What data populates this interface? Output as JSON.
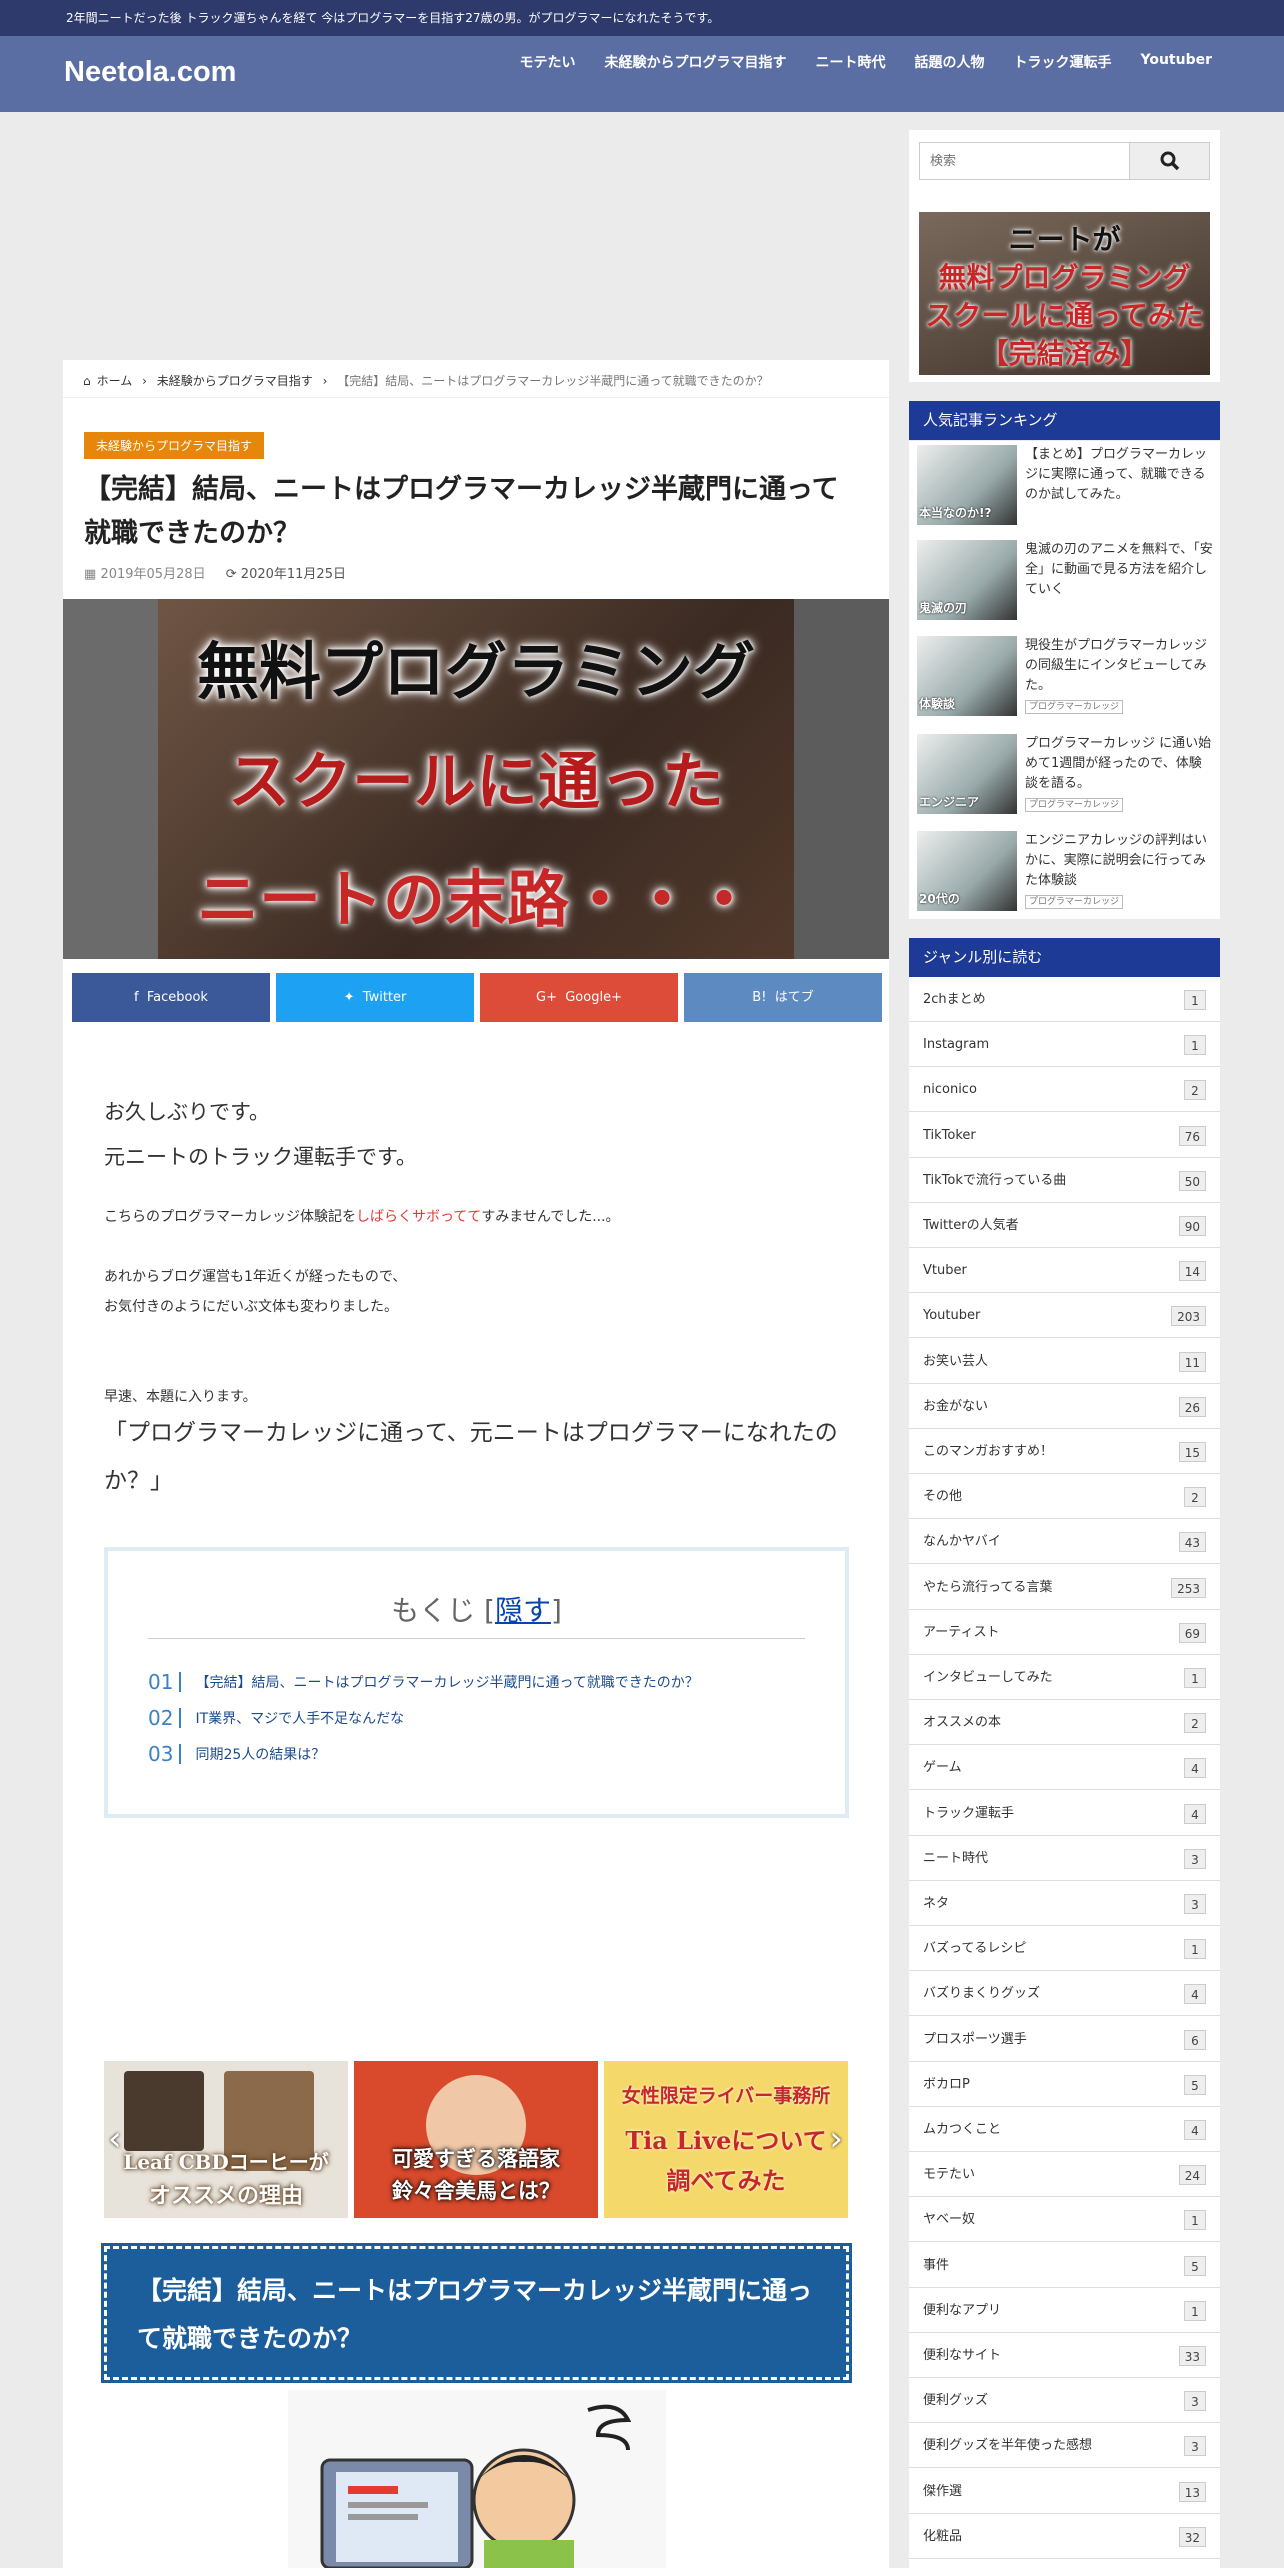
{
  "topbar": {
    "text": "2年間ニートだった後 トラック運ちゃんを経て 今はプログラマーを目指す27歳の男。がプログラマーになれたそうです。"
  },
  "header": {
    "logo": "Neetola.com",
    "nav": [
      "モテたい",
      "未経験からプログラマ目指す",
      "ニート時代",
      "話題の人物",
      "トラック運転手",
      "Youtuber"
    ]
  },
  "breadcrumb": {
    "home": "ホーム",
    "category": "未経験からプログラマ目指す",
    "current": "【完結】結局、ニートはプログラマーカレッジ半蔵門に通って就職できたのか？"
  },
  "article": {
    "category_label": "未経験からプログラマ目指す",
    "title": "【完結】結局、ニートはプログラマーカレッジ半蔵門に通って就職できたのか？",
    "published": "2019年05月28日",
    "updated": "2020年11月25日",
    "eyecatch": {
      "line1": "無料プログラミング",
      "line2": "スクールに通った",
      "line3": "ニートの末路・・・"
    },
    "share": {
      "facebook": "Facebook",
      "twitter": "Twitter",
      "google": "Google+",
      "hatena": "はてブ"
    },
    "intro1": "お久しぶりです。",
    "intro2": "元ニートのトラック運転手です。",
    "para1_pre": "こちらのプログラマーカレッジ体験記を",
    "para1_red": "しばらくサボってて",
    "para1_post": "すみませんでした...。",
    "para2_l1": "あれからブログ運営も1年近くが経ったもので、",
    "para2_l2": "お気付きのようにだいぶ文体も変わりました。",
    "para3": "早速、本題に入ります。",
    "quote": "「プログラマーカレッジに通って、元ニートはプログラマーになれたのか？」",
    "toc": {
      "title": "もくじ",
      "toggle": "隠す",
      "items": [
        {
          "num": "01",
          "text": "【完結】結局、ニートはプログラマーカレッジ半蔵門に通って就職できたのか？"
        },
        {
          "num": "02",
          "text": "IT業界、マジで人手不足なんだな"
        },
        {
          "num": "03",
          "text": "同期25人の結果は？"
        }
      ]
    },
    "slides": [
      {
        "line1": "Leaf CBDコーヒーが",
        "line2": "オススメの理由"
      },
      {
        "line1": "可愛すぎる落語家",
        "line2": "鈴々舎美馬とは？"
      },
      {
        "line1": "女性限定ライバー事務所",
        "line2": "Tia Liveについて",
        "line3": "調べてみた"
      }
    ],
    "h2": "【完結】結局、ニートはプログラマーカレッジ半蔵門に通って就職できたのか？"
  },
  "sidebar": {
    "search_placeholder": "検索",
    "banner": {
      "line1": "ニートが",
      "line2": "無料プログラミング",
      "line3": "スクールに通ってみた",
      "line4": "【完結済み】"
    },
    "ranking_title": "人気記事ランキング",
    "ranking": [
      {
        "text": "【まとめ】プログラマーカレッジに実際に通って、就職できるのか試してみた。",
        "tag": "",
        "thumb": "本当なのか!?"
      },
      {
        "text": "鬼滅の刃のアニメを無料で、「安全」に動画で見る方法を紹介していく",
        "tag": "",
        "thumb": "鬼滅の刃"
      },
      {
        "text": "現役生がプログラマーカレッジの同級生にインタビューしてみた。",
        "tag": "プログラマーカレッジ",
        "thumb": "体験談"
      },
      {
        "text": "プログラマーカレッジ に通い始めて1週間が経ったので、体験談を語る。",
        "tag": "プログラマーカレッジ",
        "thumb": "エンジニア"
      },
      {
        "text": "エンジニアカレッジの評判はいかに、実際に説明会に行ってみた体験談",
        "tag": "プログラマーカレッジ",
        "thumb": "20代の"
      }
    ],
    "genre_title": "ジャンル別に読む",
    "genres": [
      {
        "name": "2chまとめ",
        "count": "1"
      },
      {
        "name": "Instagram",
        "count": "1"
      },
      {
        "name": "niconico",
        "count": "2"
      },
      {
        "name": "TikToker",
        "count": "76"
      },
      {
        "name": "TikTokで流行っている曲",
        "count": "50"
      },
      {
        "name": "Twitterの人気者",
        "count": "90"
      },
      {
        "name": "Vtuber",
        "count": "14"
      },
      {
        "name": "Youtuber",
        "count": "203"
      },
      {
        "name": "お笑い芸人",
        "count": "11"
      },
      {
        "name": "お金がない",
        "count": "26"
      },
      {
        "name": "このマンガおすすめ！",
        "count": "15"
      },
      {
        "name": "その他",
        "count": "2"
      },
      {
        "name": "なんかヤバイ",
        "count": "43"
      },
      {
        "name": "やたら流行ってる言葉",
        "count": "253"
      },
      {
        "name": "アーティスト",
        "count": "69"
      },
      {
        "name": "インタビューしてみた",
        "count": "1"
      },
      {
        "name": "オススメの本",
        "count": "2"
      },
      {
        "name": "ゲーム",
        "count": "4"
      },
      {
        "name": "トラック運転手",
        "count": "4"
      },
      {
        "name": "ニート時代",
        "count": "3"
      },
      {
        "name": "ネタ",
        "count": "3"
      },
      {
        "name": "バズってるレシピ",
        "count": "1"
      },
      {
        "name": "バズりまくりグッズ",
        "count": "4"
      },
      {
        "name": "プロスポーツ選手",
        "count": "6"
      },
      {
        "name": "ボカロP",
        "count": "5"
      },
      {
        "name": "ムカつくこと",
        "count": "4"
      },
      {
        "name": "モテたい",
        "count": "24"
      },
      {
        "name": "ヤベー奴",
        "count": "1"
      },
      {
        "name": "事件",
        "count": "5"
      },
      {
        "name": "便利なアプリ",
        "count": "1"
      },
      {
        "name": "便利なサイト",
        "count": "33"
      },
      {
        "name": "便利グッズ",
        "count": "3"
      },
      {
        "name": "便利グッズを半年使った感想",
        "count": "3"
      },
      {
        "name": "傑作選",
        "count": "13"
      },
      {
        "name": "化粧品",
        "count": "32"
      }
    ]
  }
}
